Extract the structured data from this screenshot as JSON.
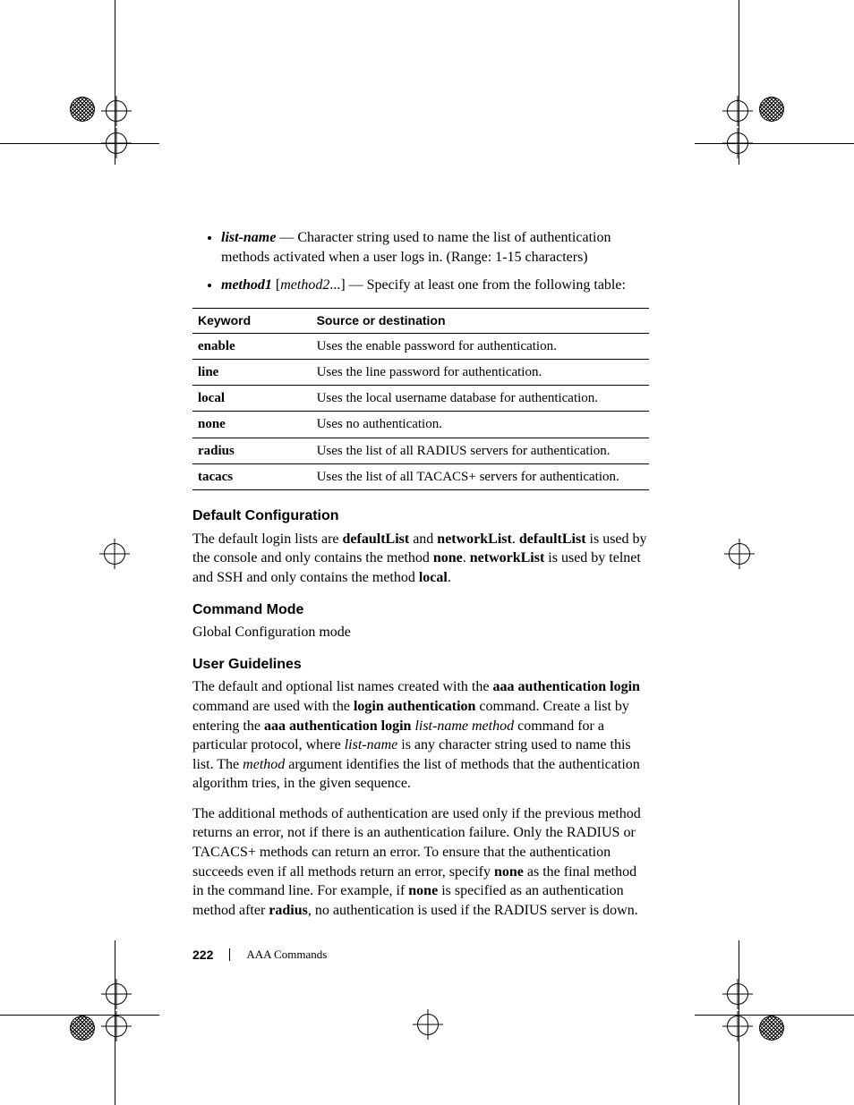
{
  "bullets": [
    {
      "term": "list-name",
      "sep": " — ",
      "desc": "Character string used to name the list of authentication methods activated when a user logs in. (Range: 1-15 characters)"
    },
    {
      "term": "method1",
      "bracket_open": " [",
      "opt": "method2",
      "bracket_close": "...] ",
      "sep": "— ",
      "desc": "Specify at least one from the following table:"
    }
  ],
  "table": {
    "head": {
      "c1": "Keyword",
      "c2": "Source or destination"
    },
    "rows": [
      {
        "k": "enable",
        "d": "Uses the enable password for authentication."
      },
      {
        "k": "line",
        "d": "Uses the line password for authentication."
      },
      {
        "k": "local",
        "d": "Uses the local username database for authentication."
      },
      {
        "k": "none",
        "d": "Uses no authentication."
      },
      {
        "k": "radius",
        "d": "Uses the list of all RADIUS servers for authentication."
      },
      {
        "k": "tacacs",
        "d": "Uses the list of all TACACS+ servers for authentication."
      }
    ]
  },
  "sections": {
    "default_cfg": {
      "title": "Default Configuration",
      "p": {
        "t1": "The default login lists are ",
        "b1": "defaultList",
        "t2": " and ",
        "b2": "networkList",
        "t3": ". ",
        "b3": "defaultList",
        "t4": " is used by the console and only contains the method ",
        "b4": "none",
        "t5": ". ",
        "b5": "networkList",
        "t6": " is used by telnet and SSH and only contains the method ",
        "b6": "local",
        "t7": "."
      }
    },
    "cmd_mode": {
      "title": "Command Mode",
      "body": "Global Configuration mode"
    },
    "user_guidelines": {
      "title": "User Guidelines",
      "p1": {
        "t1": "The default and optional list names created with the ",
        "b1": "aaa authentication login",
        "t2": " command are used with the ",
        "b2": "login authentication",
        "t3": " command. Create a list by entering the ",
        "b3": "aaa authentication login",
        "t4": " ",
        "i1": "list-name method",
        "t5": " command for a particular protocol, where ",
        "i2": "list-name",
        "t6": " is any character string used to name this list. The ",
        "i3": "method",
        "t7": " argument identifies the list of methods that the authentication algorithm tries, in the given sequence."
      },
      "p2": {
        "t1": "The additional methods of authentication are used only if the previous method returns an error, not if there is an authentication failure. Only the RADIUS or TACACS+ methods can return an error. To ensure that the authentication succeeds even if all methods return an error, specify ",
        "b1": "none",
        "t2": " as the final method in the command line. For example, if ",
        "b2": "none",
        "t3": " is specified as an authentication method after ",
        "b3": "radius",
        "t4": ", no authentication is used if the RADIUS server is down."
      }
    }
  },
  "footer": {
    "page": "222",
    "section": "AAA Commands"
  }
}
